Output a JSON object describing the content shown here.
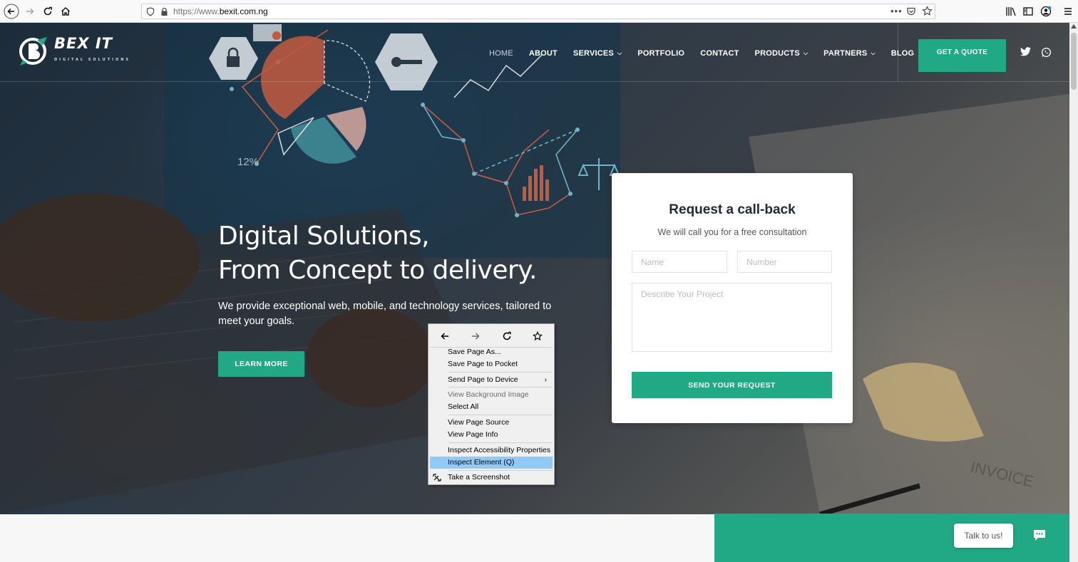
{
  "browser": {
    "url_protocol": "https://www.",
    "url_domain": "bexit.com.ng",
    "icons": [
      "back-icon",
      "forward-icon",
      "reload-icon",
      "home-icon",
      "shield-icon",
      "lock-icon",
      "more-icon",
      "pocket-icon",
      "bookmark-star-icon",
      "library-icon",
      "sidebar-icon",
      "account-icon",
      "menu-icon"
    ]
  },
  "site": {
    "logo_text": "BEX IT",
    "logo_sub": "DIGITAL SOLUTIONS",
    "nav": [
      {
        "label": "HOME",
        "dropdown": false,
        "active": true
      },
      {
        "label": "ABOUT",
        "dropdown": false
      },
      {
        "label": "SERVICES",
        "dropdown": true
      },
      {
        "label": "PORTFOLIO",
        "dropdown": false
      },
      {
        "label": "CONTACT",
        "dropdown": false
      },
      {
        "label": "PRODUCTS",
        "dropdown": true
      },
      {
        "label": "PARTNERS",
        "dropdown": true
      },
      {
        "label": "BLOG",
        "dropdown": false
      }
    ],
    "quote_button": "GET A QUOTE",
    "social": [
      "twitter-icon",
      "whatsapp-icon"
    ]
  },
  "hero": {
    "headline_line1": "Digital Solutions,",
    "headline_line2": "From Concept to delivery.",
    "subtext": "We provide exceptional web, mobile, and technology services, tailored to meet your goals.",
    "learn_more": "LEARN MORE",
    "art_label": "12%"
  },
  "form": {
    "title": "Request a call-back",
    "subtitle": "We will call you for a free consultation",
    "name_placeholder": "Name",
    "number_placeholder": "Number",
    "project_placeholder": "Describe Your Project",
    "send_button": "SEND YOUR REQUEST"
  },
  "chat": {
    "bubble_text": "Talk to us!"
  },
  "context_menu": {
    "items": [
      {
        "label": "Save Page As...",
        "disabled": false
      },
      {
        "label": "Save Page to Pocket",
        "disabled": false
      },
      {
        "label": "Send Page to Device",
        "disabled": false,
        "submenu": true
      },
      {
        "label": "View Background Image",
        "disabled": true
      },
      {
        "label": "Select All",
        "disabled": false
      },
      {
        "label": "View Page Source",
        "disabled": false
      },
      {
        "label": "View Page Info",
        "disabled": false
      },
      {
        "label": "Inspect Accessibility Properties",
        "disabled": false
      },
      {
        "label": "Inspect Element (Q)",
        "disabled": false,
        "highlighted": true
      },
      {
        "label": "Take a Screenshot",
        "disabled": false
      }
    ]
  },
  "colors": {
    "accent": "#21a884",
    "highlight": "#91c9f7"
  }
}
